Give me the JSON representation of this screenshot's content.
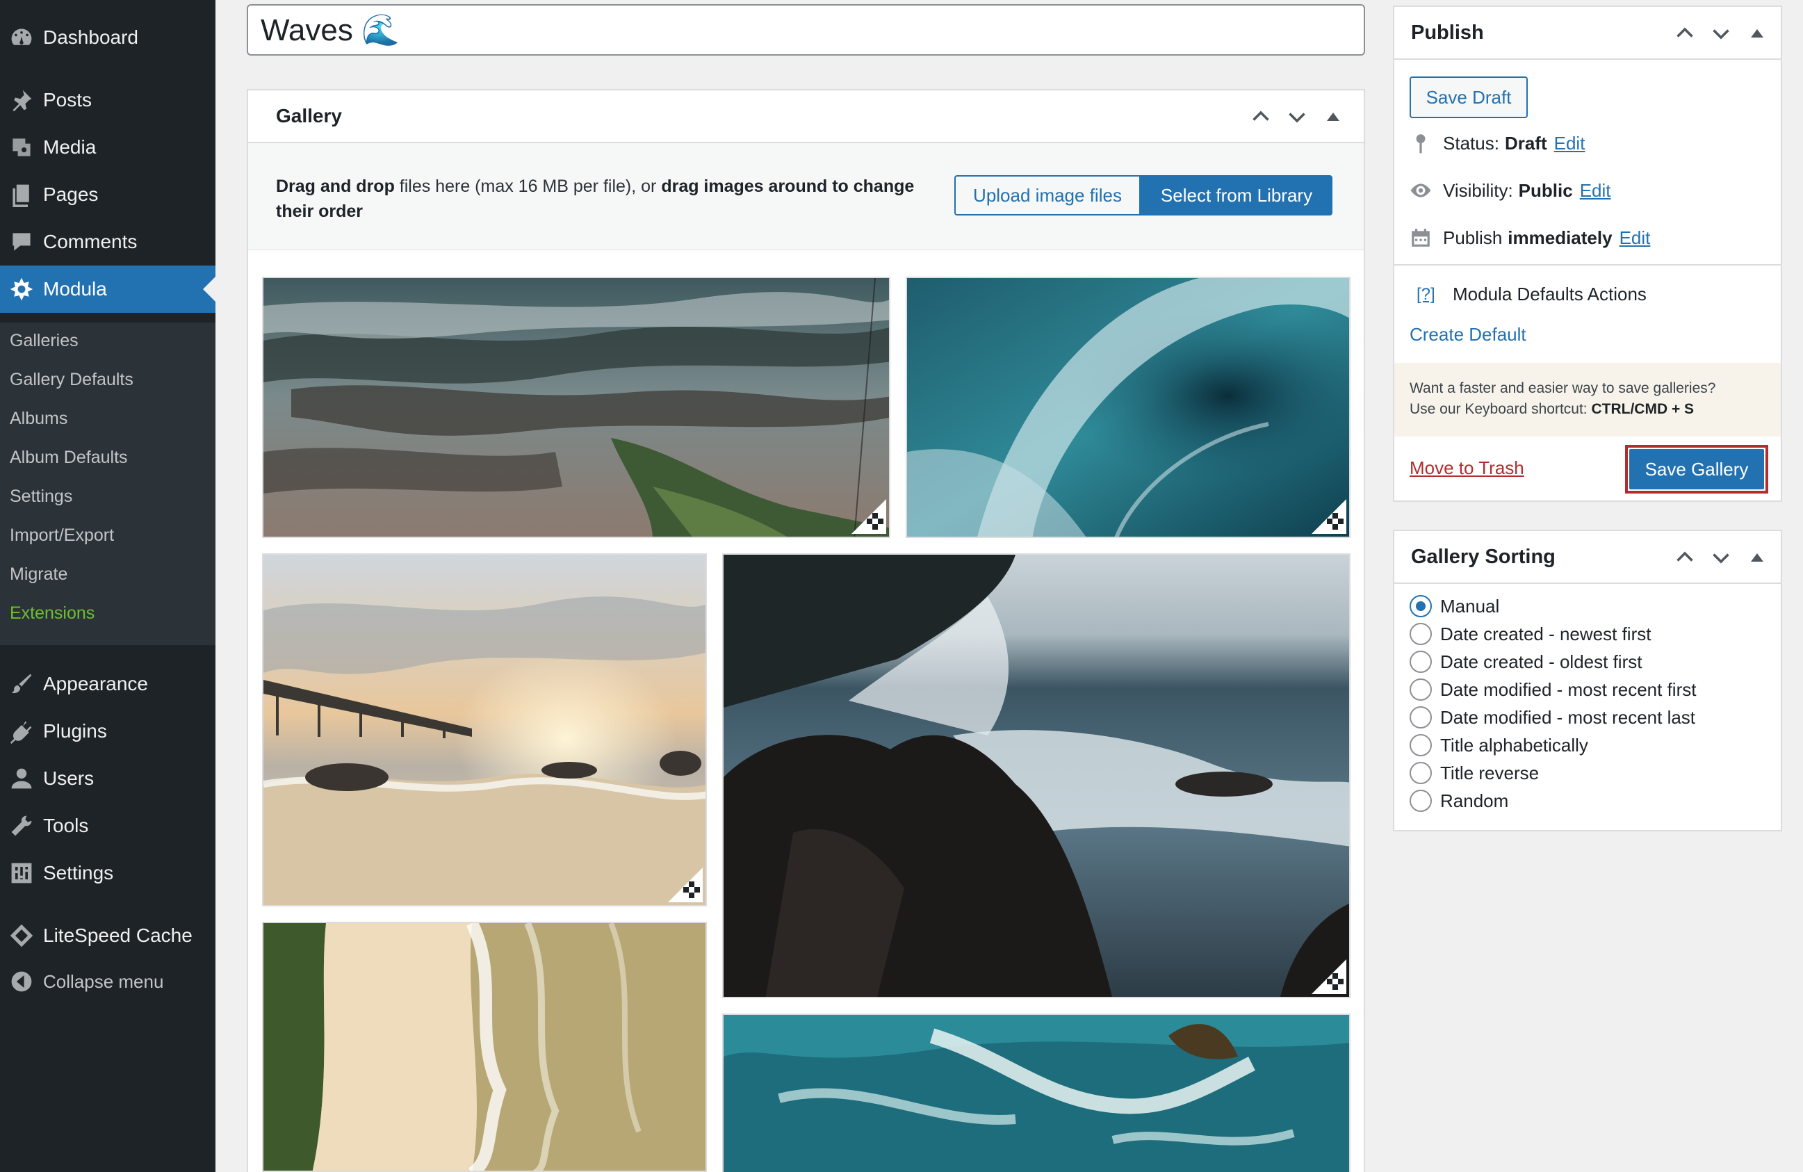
{
  "title_input": {
    "value": "Waves 🌊"
  },
  "sidebar": {
    "menu": [
      {
        "id": "dashboard",
        "label": "Dashboard",
        "icon": "dashboard-icon"
      },
      {
        "id": "posts",
        "label": "Posts",
        "icon": "pin-icon"
      },
      {
        "id": "media",
        "label": "Media",
        "icon": "media-icon"
      },
      {
        "id": "pages",
        "label": "Pages",
        "icon": "pages-icon"
      },
      {
        "id": "comments",
        "label": "Comments",
        "icon": "comment-icon"
      },
      {
        "id": "modula",
        "label": "Modula",
        "icon": "modula-icon",
        "active": true
      },
      {
        "id": "appearance",
        "label": "Appearance",
        "icon": "paintbrush-icon"
      },
      {
        "id": "plugins",
        "label": "Plugins",
        "icon": "plug-icon"
      },
      {
        "id": "users",
        "label": "Users",
        "icon": "user-icon"
      },
      {
        "id": "tools",
        "label": "Tools",
        "icon": "wrench-icon"
      },
      {
        "id": "settings",
        "label": "Settings",
        "icon": "settings-icon"
      },
      {
        "id": "litespeed",
        "label": "LiteSpeed Cache",
        "icon": "diamond-icon"
      },
      {
        "id": "collapse",
        "label": "Collapse menu",
        "icon": "collapse-icon"
      }
    ],
    "submenu": [
      {
        "label": "Galleries"
      },
      {
        "label": "Gallery Defaults"
      },
      {
        "label": "Albums"
      },
      {
        "label": "Album Defaults"
      },
      {
        "label": "Settings"
      },
      {
        "label": "Import/Export"
      },
      {
        "label": "Migrate"
      },
      {
        "label": "Extensions",
        "highlight": "#6dbf2d"
      }
    ]
  },
  "gallery": {
    "title": "Gallery",
    "instructions": {
      "bold1": "Drag and drop",
      "text1": " files here (max 16 MB per file), or ",
      "bold2": "drag images around to change their order"
    },
    "upload_button": "Upload image files",
    "library_button": "Select from Library",
    "images": [
      {
        "name": "aerial-coast-photo",
        "theme": "aerial coast with surf"
      },
      {
        "name": "barrel-wave-photo",
        "theme": "teal barrel wave"
      },
      {
        "name": "pier-sunset-photo",
        "theme": "pier at sunset"
      },
      {
        "name": "rocky-surf-photo",
        "theme": "waves crashing on dark rocks"
      },
      {
        "name": "aerial-beach-photo",
        "theme": "aerial sandy beach"
      },
      {
        "name": "turquoise-waves-photo",
        "theme": "turquoise sea foam"
      }
    ]
  },
  "publish": {
    "title": "Publish",
    "save_draft": "Save Draft",
    "status_label": "Status:",
    "status_value": "Draft",
    "visibility_label": "Visibility:",
    "visibility_value": "Public",
    "publish_label": "Publish",
    "publish_value": "immediately",
    "edit": "Edit",
    "help_link": "[?]",
    "defaults_label": "Modula Defaults Actions",
    "create_default": "Create Default",
    "notice_line1": "Want a faster and easier way to save galleries?",
    "notice_line2": "Use our Keyboard shortcut: ",
    "notice_shortcut": "CTRL/CMD + S",
    "move_to_trash": "Move to Trash",
    "save_gallery": "Save Gallery"
  },
  "sorting": {
    "title": "Gallery Sorting",
    "options": [
      {
        "label": "Manual",
        "checked": true
      },
      {
        "label": "Date created - newest first",
        "checked": false
      },
      {
        "label": "Date created - oldest first",
        "checked": false
      },
      {
        "label": "Date modified - most recent first",
        "checked": false
      },
      {
        "label": "Date modified - most recent last",
        "checked": false
      },
      {
        "label": "Title alphabetically",
        "checked": false
      },
      {
        "label": "Title reverse",
        "checked": false
      },
      {
        "label": "Random",
        "checked": false
      }
    ]
  },
  "colors": {
    "accent": "#2271b1",
    "sidebar": "#1d2327",
    "submenu": "#2c3338",
    "danger": "#b32d2e"
  }
}
